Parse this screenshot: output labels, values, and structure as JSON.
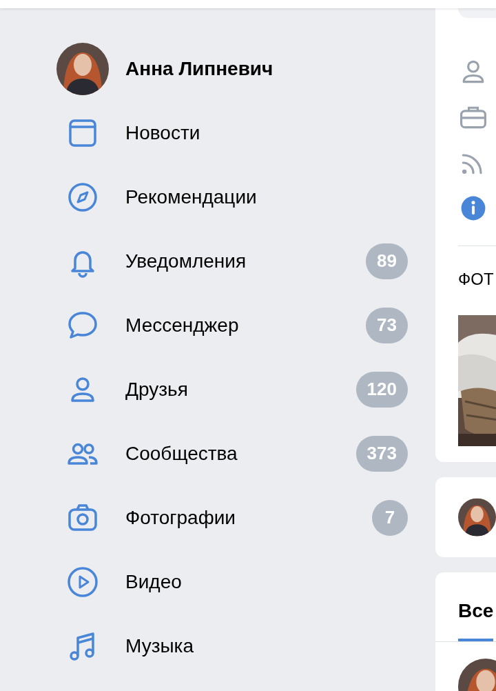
{
  "profile": {
    "name": "Анна Липневич"
  },
  "menu": [
    {
      "kind": "news",
      "label": "Новости"
    },
    {
      "kind": "compass",
      "label": "Рекомендации"
    },
    {
      "kind": "bell",
      "label": "Уведомления",
      "count": "89"
    },
    {
      "kind": "chat",
      "label": "Мессенджер",
      "count": "73"
    },
    {
      "kind": "person",
      "label": "Друзья",
      "count": "120"
    },
    {
      "kind": "group",
      "label": "Сообщества",
      "count": "373"
    },
    {
      "kind": "camera",
      "label": "Фотографии",
      "count": "7"
    },
    {
      "kind": "video",
      "label": "Видео"
    },
    {
      "kind": "music",
      "label": "Музыка"
    }
  ],
  "info_card": {
    "icons": [
      {
        "kind": "person"
      },
      {
        "kind": "briefcase"
      },
      {
        "kind": "rss"
      },
      {
        "kind": "info"
      }
    ]
  },
  "photos": {
    "title": "ФОТ"
  },
  "tabs": [
    {
      "label": "Все",
      "selected": true
    }
  ]
}
